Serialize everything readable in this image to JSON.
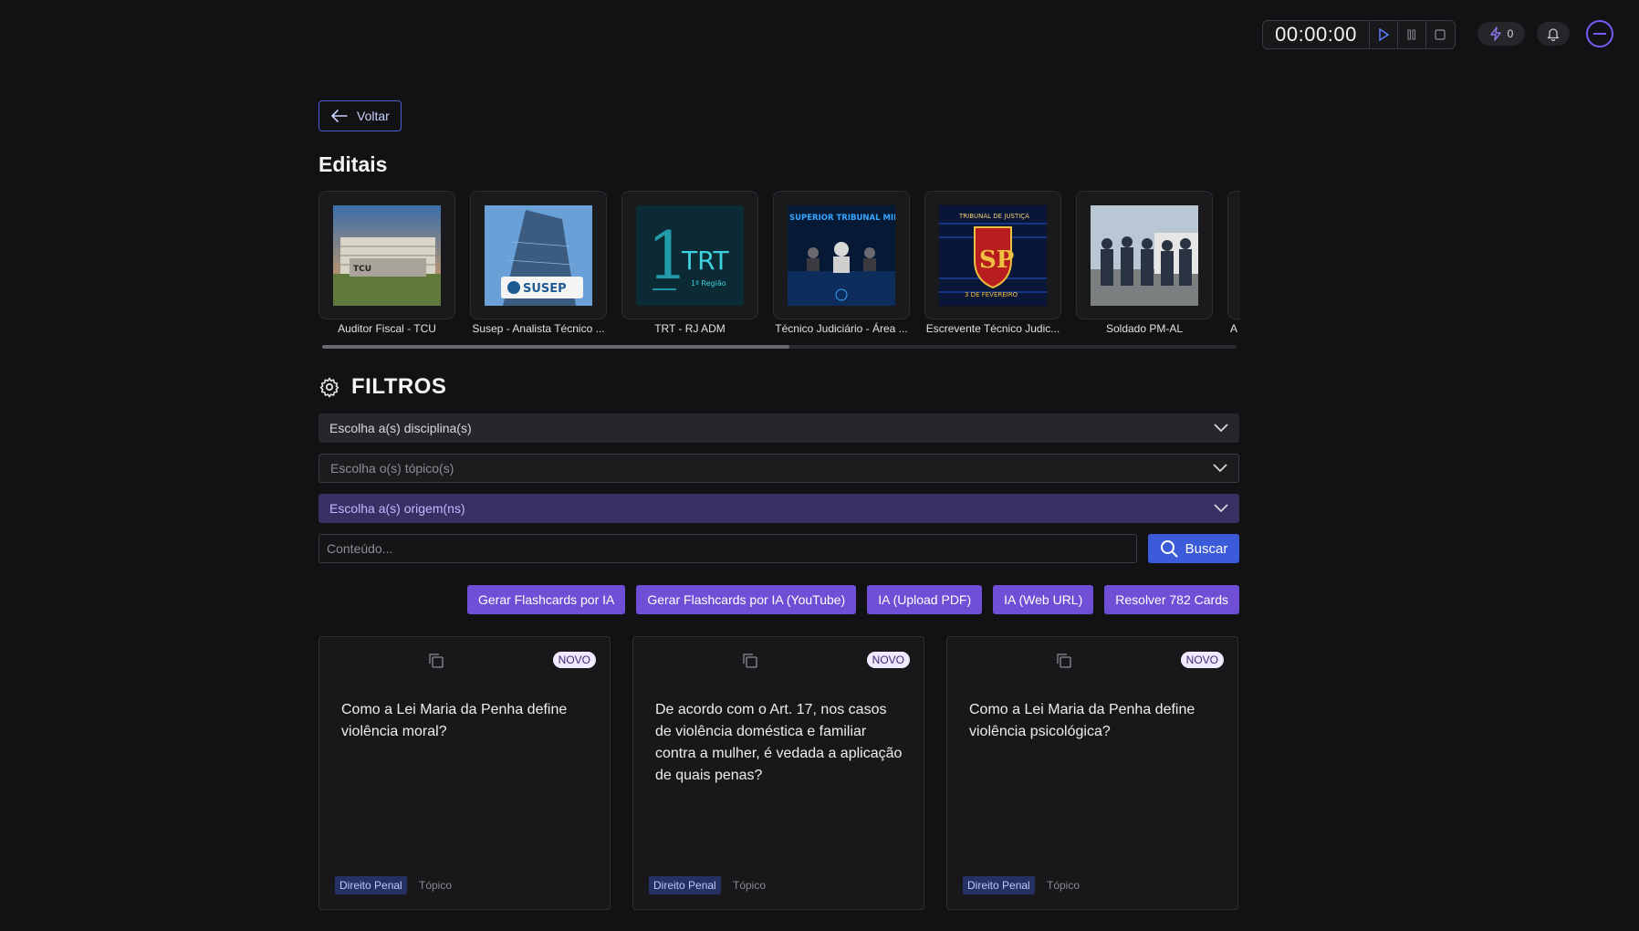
{
  "header": {
    "timer": "00:00:00",
    "energy_count": "0"
  },
  "back_label": "Voltar",
  "editais": {
    "title": "Editais",
    "items": [
      {
        "label": "Auditor Fiscal - TCU",
        "thumb": "tcu-building-photo"
      },
      {
        "label": "Susep - Analista Técnico ...",
        "thumb": "susep-building-photo"
      },
      {
        "label": "TRT - RJ ADM",
        "thumb": "trt-logo"
      },
      {
        "label": "Técnico Judiciário - Área ...",
        "thumb": "stm-court-photo"
      },
      {
        "label": "Escrevente Técnico Judic...",
        "thumb": "tjsp-emblem"
      },
      {
        "label": "Soldado PM-AL",
        "thumb": "pm-al-officers-photo"
      },
      {
        "label": "A",
        "thumb": "partial-card"
      }
    ]
  },
  "filters": {
    "title": "FILTROS",
    "disciplina_placeholder": "Escolha a(s) disciplina(s)",
    "topico_placeholder": "Escolha o(s) tópico(s)",
    "origem_placeholder": "Escolha a(s) origem(ns)",
    "content_placeholder": "Conteúdo...",
    "search_label": "Buscar"
  },
  "actions": [
    "Gerar Flashcards por IA",
    "Gerar Flashcards por IA (YouTube)",
    "IA (Upload PDF)",
    "IA (Web URL)",
    "Resolver 782 Cards"
  ],
  "cards": [
    {
      "badge": "NOVO",
      "question": "Como a Lei Maria da Penha define violência moral?",
      "tag": "Direito Penal",
      "topic": "Tópico"
    },
    {
      "badge": "NOVO",
      "question": "De acordo com o Art. 17, nos casos de violência doméstica e familiar contra a mulher, é vedada a aplicação de quais penas?",
      "tag": "Direito Penal",
      "topic": "Tópico"
    },
    {
      "badge": "NOVO",
      "question": "Como a Lei Maria da Penha define violência psicológica?",
      "tag": "Direito Penal",
      "topic": "Tópico"
    }
  ],
  "colors": {
    "background": "#121214",
    "accent_purple": "#6e4fd6",
    "accent_blue": "#3b5bdb"
  }
}
